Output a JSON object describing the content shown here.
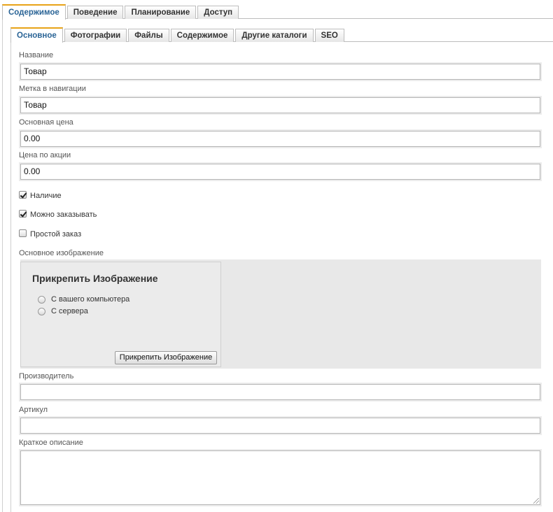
{
  "outer_tabs": [
    "Содержимое",
    "Поведение",
    "Планирование",
    "Доступ"
  ],
  "inner_tabs": [
    "Основное",
    "Фотографии",
    "Файлы",
    "Содержимое",
    "Другие каталоги",
    "SEO"
  ],
  "fields": {
    "name": {
      "label": "Название",
      "value": "Товар"
    },
    "nav_label": {
      "label": "Метка в навигации",
      "value": "Товар"
    },
    "base_price": {
      "label": "Основная цена",
      "value": "0.00"
    },
    "sale_price": {
      "label": "Цена по акции",
      "value": "0.00"
    }
  },
  "checkboxes": {
    "availability": {
      "label": "Наличие",
      "checked": true
    },
    "orderable": {
      "label": "Можно заказывать",
      "checked": true
    },
    "simple_order": {
      "label": "Простой заказ",
      "checked": false
    }
  },
  "image": {
    "label": "Основное изображение",
    "title": "Прикрепить Изображение",
    "option_computer": "С вашего компьютера",
    "option_server": "С сервера",
    "button": "Прикрепить Изображение"
  },
  "manufacturer": {
    "label": "Производитель",
    "value": ""
  },
  "sku": {
    "label": "Артикул",
    "value": ""
  },
  "short_description": {
    "label": "Краткое описание",
    "value": ""
  },
  "colors": {
    "active_tab_accent": "#e8a317",
    "active_tab_text": "#2a6496"
  }
}
